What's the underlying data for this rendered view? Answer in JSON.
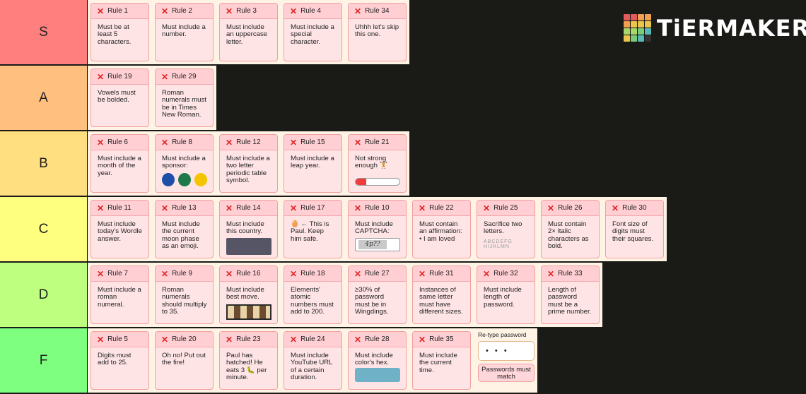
{
  "logo": {
    "text": "TiERMAKER",
    "grid_colors": [
      "#e35b5b",
      "#e35b5b",
      "#f0a050",
      "#f0a050",
      "#f0a050",
      "#e9c64b",
      "#e9c64b",
      "#e9c64b",
      "#a8d66b",
      "#a8d66b",
      "#7acc7a",
      "#58b8b8",
      "#e9c64b",
      "#7acc7a",
      "#58b8b8",
      "#333333"
    ]
  },
  "tiers": [
    {
      "label": "S",
      "color": "#ff7f7f",
      "items": [
        {
          "title": "Rule 1",
          "text": "Must be at least 5 characters."
        },
        {
          "title": "Rule 2",
          "text": "Must include a number."
        },
        {
          "title": "Rule 3",
          "text": "Must include an uppercase letter."
        },
        {
          "title": "Rule 4",
          "text": "Must include a special character."
        },
        {
          "title": "Rule 34",
          "text": "Uhhh let's skip this one."
        }
      ]
    },
    {
      "label": "A",
      "color": "#ffbf7f",
      "items": [
        {
          "title": "Rule 19",
          "text": "Vowels must be bolded."
        },
        {
          "title": "Rule 29",
          "text": "Roman numerals must be in Times New Roman."
        }
      ]
    },
    {
      "label": "B",
      "color": "#ffdf7f",
      "items": [
        {
          "title": "Rule 6",
          "text": "Must include a month of the year."
        },
        {
          "title": "Rule 8",
          "text": "Must include a sponsor:",
          "extra": "sponsors",
          "sponsor_icons": [
            "pepsi-icon",
            "starbucks-icon",
            "shell-icon"
          ],
          "sponsor_colors": [
            "#1d4fa8",
            "#1e7a4a",
            "#f5c400"
          ]
        },
        {
          "title": "Rule 12",
          "text": "Must include a two letter periodic table symbol."
        },
        {
          "title": "Rule 15",
          "text": "Must include a leap year."
        },
        {
          "title": "Rule 21",
          "text": "Not strong enough 🏋️",
          "extra": "strength",
          "strength_level": 0.24
        }
      ]
    },
    {
      "label": "C",
      "color": "#ffff7f",
      "items": [
        {
          "title": "Rule 11",
          "text": "Must include today's Wordle answer."
        },
        {
          "title": "Rule 13",
          "text": "Must include the current moon phase as an emoji."
        },
        {
          "title": "Rule 14",
          "text": "Must include this country.",
          "extra": "image"
        },
        {
          "title": "Rule 17",
          "text": "🥚 ← This is Paul. Keep him safe."
        },
        {
          "title": "Rule 10",
          "text": "Must include CAPTCHA:",
          "extra": "captcha",
          "captcha_text": "4p??"
        },
        {
          "title": "Rule 22",
          "text": "Must contain an affirmation:\n• I am loved"
        },
        {
          "title": "Rule 25",
          "text": "Sacrifice two letters.",
          "extra": "letters",
          "letters_text": "ABCDEFG HIJKLMN"
        },
        {
          "title": "Rule 26",
          "text": "Must contain 2× italic characters as bold."
        },
        {
          "title": "Rule 30",
          "text": "Font size of digits must their squares."
        }
      ]
    },
    {
      "label": "D",
      "color": "#bfff7f",
      "items": [
        {
          "title": "Rule 7",
          "text": "Must include a roman numeral."
        },
        {
          "title": "Rule 9",
          "text": "Roman numerals should multiply to 35."
        },
        {
          "title": "Rule 16",
          "text": "Must include best move.",
          "extra": "chess"
        },
        {
          "title": "Rule 18",
          "text": "Elements' atomic numbers must add to 200."
        },
        {
          "title": "Rule 27",
          "text": "≥30% of password must be in Wingdings."
        },
        {
          "title": "Rule 31",
          "text": "Instances of same letter must have different sizes."
        },
        {
          "title": "Rule 32",
          "text": "Must include length of password."
        },
        {
          "title": "Rule 33",
          "text": "Length of password must be a prime number."
        }
      ]
    },
    {
      "label": "F",
      "color": "#7fff7f",
      "items": [
        {
          "title": "Rule 5",
          "text": "Digits must add to 25."
        },
        {
          "title": "Rule 20",
          "text": "Oh no! Put out the fire!"
        },
        {
          "title": "Rule 23",
          "text": "Paul has hatched! He eats 3 🐛 per minute."
        },
        {
          "title": "Rule 24",
          "text": "Must include YouTube URL of a certain duration."
        },
        {
          "title": "Rule 28",
          "text": "Must include color's hex.",
          "extra": "color"
        },
        {
          "title": "Rule 35",
          "text": "Must include the current time."
        }
      ],
      "retype": {
        "label": "Re-type password",
        "value": "• • •",
        "button": "Passwords must match"
      }
    }
  ]
}
